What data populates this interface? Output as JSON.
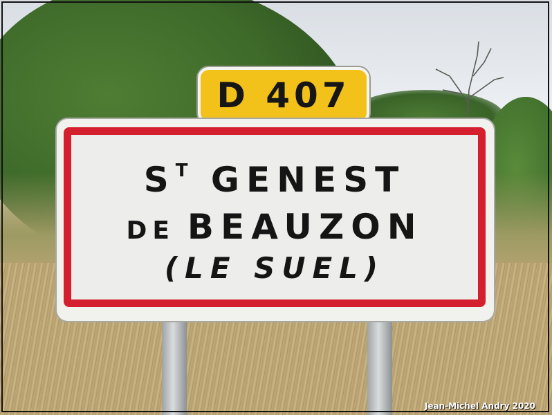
{
  "route_plate": {
    "text": "D 407"
  },
  "sign": {
    "line1_prefix": "S",
    "line1_sup": "T",
    "line1_rest": "GENEST",
    "line2_small": "DE",
    "line2_main": "BEAUZON",
    "line3": "(LE SUEL)"
  },
  "credit": "Jean-Michel Andry 2020",
  "colors": {
    "route_plate_bg": "#f2c21a",
    "sign_border": "#d4202e",
    "sign_bg": "#ededeb",
    "text": "#151515"
  }
}
